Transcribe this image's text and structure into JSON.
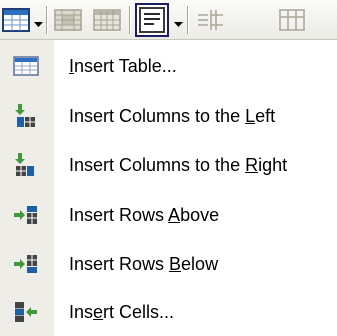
{
  "toolbar": {
    "buttons": [
      {
        "name": "insert-table-icon",
        "state": "active",
        "has_dropdown": true
      },
      {
        "name": "table-properties-icon",
        "state": "disabled"
      },
      {
        "name": "cell-properties-icon",
        "state": "disabled"
      },
      {
        "name": "text-properties-icon",
        "state": "pressed",
        "has_dropdown": true
      },
      {
        "name": "split-cells-icon",
        "state": "disabled"
      },
      {
        "name": "merge-cells-icon",
        "state": "disabled"
      }
    ]
  },
  "menu": {
    "items": [
      {
        "icon": "table-icon",
        "pre": "",
        "key": "I",
        "post": "nsert Table..."
      },
      {
        "icon": "insert-columns-left-icon",
        "pre": "Insert Columns to the ",
        "key": "L",
        "post": "eft"
      },
      {
        "icon": "insert-columns-right-icon",
        "pre": "Insert Columns to the ",
        "key": "R",
        "post": "ight"
      },
      {
        "icon": "insert-rows-above-icon",
        "pre": "Insert Rows ",
        "key": "A",
        "post": "bove"
      },
      {
        "icon": "insert-rows-below-icon",
        "pre": "Insert Rows ",
        "key": "B",
        "post": "elow"
      },
      {
        "icon": "insert-cells-icon",
        "pre": "Ins",
        "key": "e",
        "post": "rt Cells..."
      }
    ]
  },
  "colors": {
    "gutter": "#eeede7",
    "icon_blue": "#1f5fa8",
    "icon_green": "#3f9a3c",
    "pressed_border": "#1c1c6a"
  }
}
